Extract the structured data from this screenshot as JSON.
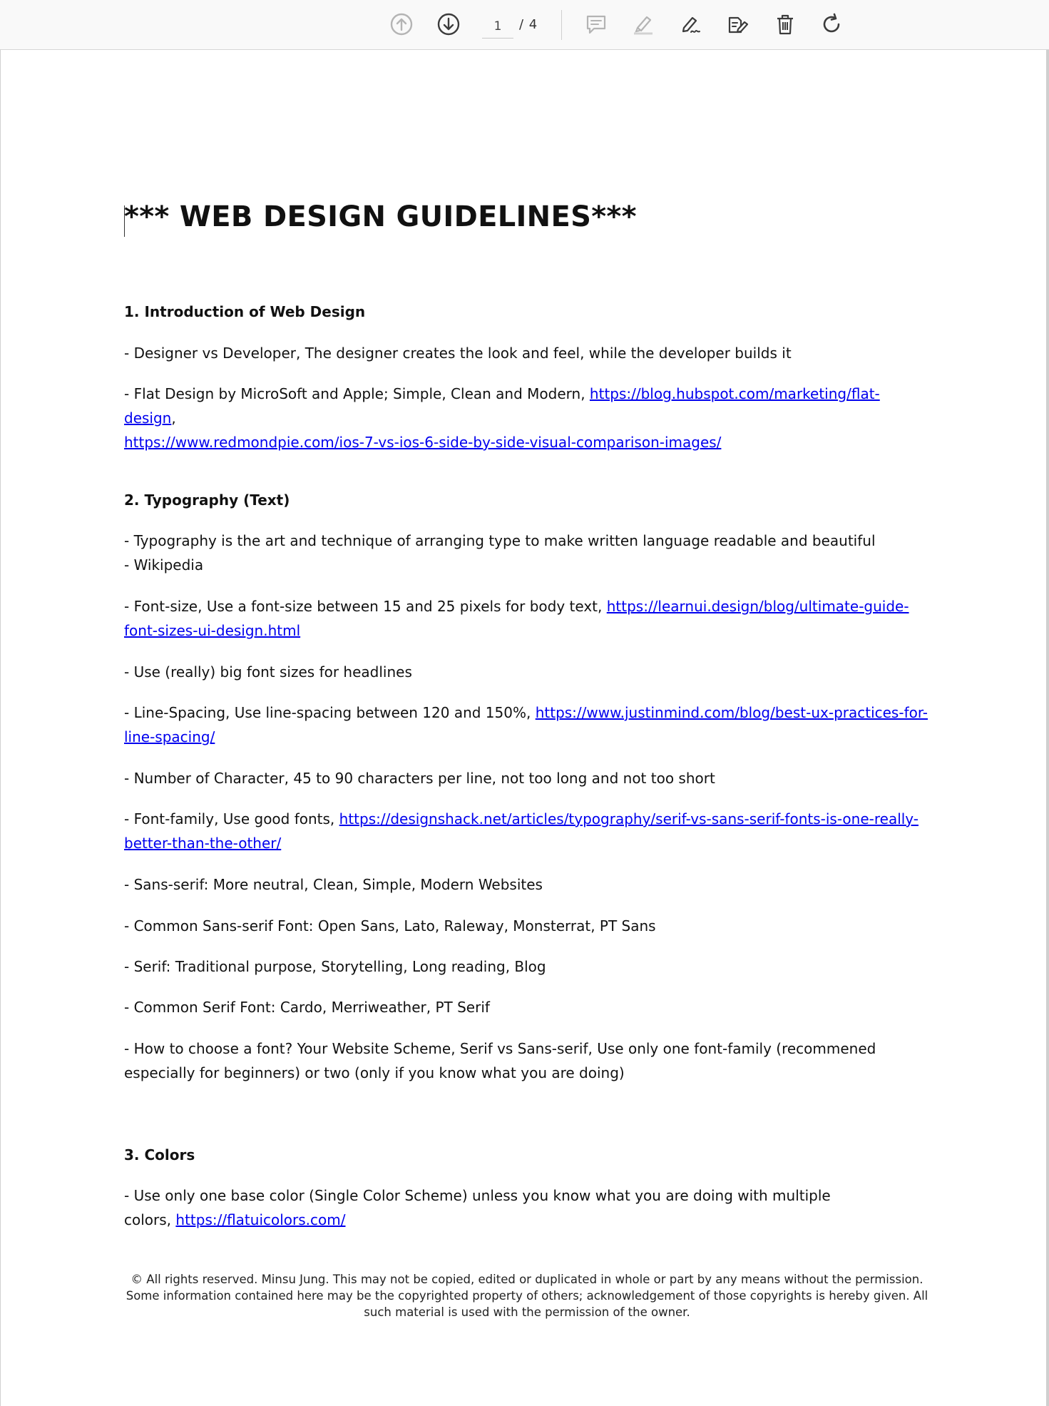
{
  "toolbar": {
    "page_current": "1",
    "page_total": "/ 4",
    "icons": {
      "prev": "arrow-up-circle-icon",
      "next": "arrow-down-circle-icon",
      "comment": "comment-icon",
      "highlight": "highlighter-icon",
      "draw": "pen-signature-icon",
      "text_edit": "edit-text-icon",
      "delete": "trash-icon",
      "rotate": "rotate-icon"
    }
  },
  "document": {
    "title": "*** WEB DESIGN GUIDELINES***",
    "s1": {
      "heading": "1. Introduction of Web Design",
      "p1": "- Designer vs Developer, The designer creates the look and feel, while the developer builds it",
      "p2_text": "- Flat Design by MicroSoft and Apple; Simple, Clean and Modern, ",
      "p2_link1": "https://blog.hubspot.com/marketing/flat-design",
      "p2_sep": ",",
      "p2_link2": "https://www.redmondpie.com/ios-7-vs-ios-6-side-by-side-visual-comparison-images/"
    },
    "s2": {
      "heading": "2. Typography (Text)",
      "p1": "- Typography is the art and technique of arranging type to make written language readable and beautiful - Wikipedia",
      "p2_text": "- Font-size, Use a font-size between 15 and 25 pixels for body text, ",
      "p2_link": "https://learnui.design/blog/ultimate-guide-font-sizes-ui-design.html",
      "p3": "- Use (really) big font sizes for headlines",
      "p4_text": "- Line-Spacing, Use line-spacing between 120 and 150%, ",
      "p4_link": "https://www.justinmind.com/blog/best-ux-practices-for-line-spacing/",
      "p5": "- Number of Character, 45 to 90 characters per line, not too long and not too short",
      "p6_text": "- Font-family, Use good fonts, ",
      "p6_link": "https://designshack.net/articles/typography/serif-vs-sans-serif-fonts-is-one-really-better-than-the-other/",
      "p7": "- Sans-serif: More neutral, Clean, Simple, Modern Websites",
      "p8": "- Common Sans-serif Font: Open Sans, Lato, Raleway, Monsterrat, PT Sans",
      "p9": "- Serif: Traditional purpose, Storytelling, Long reading, Blog",
      "p10": "- Common Serif Font: Cardo, Merriweather, PT Serif",
      "p11": "- How to choose a font? Your Website Scheme, Serif vs Sans-serif, Use only one font-family (recommened especially for beginners) or two (only if you know what you are doing)"
    },
    "s3": {
      "heading": "3. Colors",
      "p1_text": "- Use only one base color (Single Color Scheme) unless you know what you are doing with multiple colors, ",
      "p1_link": "https://flatuicolors.com/"
    },
    "footer": "© All rights reserved. Minsu Jung. This may not be copied, edited or duplicated in whole or part by any means without the permission. Some information contained here may be the copyrighted property of others; acknowledgement of those copyrights is hereby given. All such material is used with the permission of the owner."
  },
  "colors": {
    "link": "#0000ee",
    "toolbar_bg": "#f9f9f9",
    "icon": "#3c3c3c",
    "icon_disabled": "#b4b4b4"
  }
}
